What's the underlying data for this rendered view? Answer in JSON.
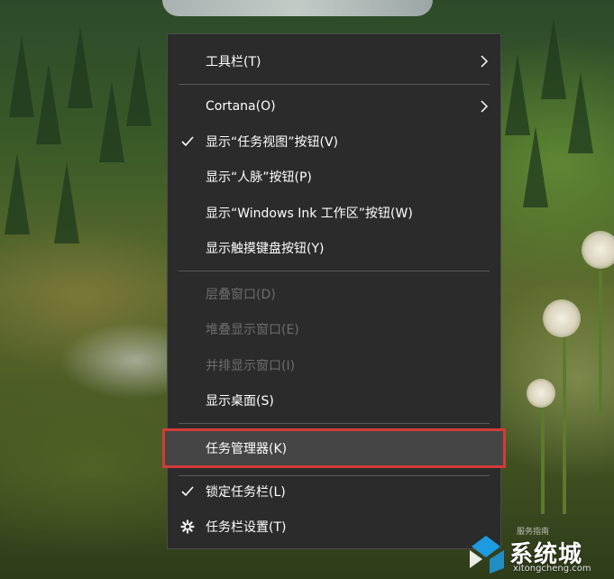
{
  "menu": {
    "items": [
      {
        "label": "工具栏(T)",
        "checked": false,
        "submenu": true,
        "disabled": false
      },
      {
        "label": "Cortana(O)",
        "checked": false,
        "submenu": true,
        "disabled": false
      },
      {
        "label": "显示“任务视图”按钮(V)",
        "checked": true,
        "submenu": false,
        "disabled": false
      },
      {
        "label": "显示“人脉”按钮(P)",
        "checked": false,
        "submenu": false,
        "disabled": false
      },
      {
        "label": "显示“Windows Ink 工作区”按钮(W)",
        "checked": false,
        "submenu": false,
        "disabled": false
      },
      {
        "label": "显示触摸键盘按钮(Y)",
        "checked": false,
        "submenu": false,
        "disabled": false
      },
      {
        "label": "层叠窗口(D)",
        "checked": false,
        "submenu": false,
        "disabled": true
      },
      {
        "label": "堆叠显示窗口(E)",
        "checked": false,
        "submenu": false,
        "disabled": true
      },
      {
        "label": "并排显示窗口(I)",
        "checked": false,
        "submenu": false,
        "disabled": true
      },
      {
        "label": "显示桌面(S)",
        "checked": false,
        "submenu": false,
        "disabled": false
      },
      {
        "label": "任务管理器(K)",
        "checked": false,
        "submenu": false,
        "disabled": false,
        "highlighted": true
      },
      {
        "label": "锁定任务栏(L)",
        "checked": true,
        "submenu": false,
        "disabled": false
      },
      {
        "label": "任务栏设置(T)",
        "checked": false,
        "submenu": false,
        "disabled": false,
        "icon": "gear-icon"
      }
    ]
  },
  "watermark": {
    "brand": "系统城",
    "url": "xitongcheng.com",
    "small": "服务指南"
  },
  "colors": {
    "menu_bg": "#2b2b2b",
    "highlight_bg": "#454545",
    "highlight_border": "#d43a3a",
    "disabled_text": "#6d6d6d",
    "watermark_blue": "#1e9be0"
  }
}
